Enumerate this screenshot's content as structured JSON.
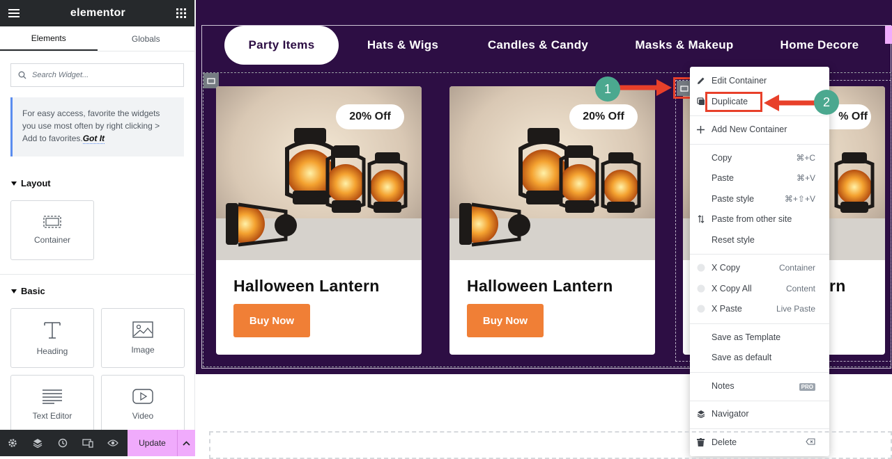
{
  "app": {
    "logo": "elementor"
  },
  "panel": {
    "tabs": [
      {
        "label": "Elements"
      },
      {
        "label": "Globals"
      }
    ],
    "search_placeholder": "Search Widget...",
    "tip_text": "For easy access, favorite the widgets you use most often by right clicking > Add to favorites.",
    "tip_link": "Got It",
    "layout_title": "Layout",
    "layout_widgets": [
      {
        "label": "Container"
      }
    ],
    "basic_title": "Basic",
    "basic_widgets": [
      {
        "label": "Heading"
      },
      {
        "label": "Image"
      },
      {
        "label": "Text Editor"
      },
      {
        "label": "Video"
      }
    ],
    "update_label": "Update"
  },
  "nav": {
    "items": [
      {
        "label": "Party Items"
      },
      {
        "label": "Hats & Wigs"
      },
      {
        "label": "Candles & Candy"
      },
      {
        "label": "Masks & Makeup"
      },
      {
        "label": "Home Decore"
      }
    ]
  },
  "cards": [
    {
      "badge": "20% Off",
      "title": "Halloween Lantern",
      "button": "Buy Now"
    },
    {
      "badge": "20% Off",
      "title": "Halloween Lantern",
      "button": "Buy Now"
    },
    {
      "badge": "% Off",
      "title": "rn"
    }
  ],
  "context_menu": {
    "items": [
      {
        "label": "Edit Container",
        "icon": "pencil-icon"
      },
      {
        "label": "Duplicate",
        "icon": "duplicate-icon"
      },
      {
        "label": "Add New Container",
        "icon": "plus-icon"
      },
      {
        "label": "Copy",
        "shortcut": "⌘+C"
      },
      {
        "label": "Paste",
        "shortcut": "⌘+V"
      },
      {
        "label": "Paste style",
        "shortcut": "⌘+⇧+V"
      },
      {
        "label": "Paste from other site",
        "icon": "arrows-icon"
      },
      {
        "label": "Reset style"
      },
      {
        "label": "X Copy",
        "shortcut": "Container",
        "icon": "xcopy-icon"
      },
      {
        "label": "X Copy All",
        "shortcut": "Content",
        "icon": "xcopy-icon"
      },
      {
        "label": "X Paste",
        "shortcut": "Live Paste",
        "icon": "xcopy-icon"
      },
      {
        "label": "Save as Template"
      },
      {
        "label": "Save as default"
      },
      {
        "label": "Notes",
        "badge": "PRO"
      },
      {
        "label": "Navigator",
        "icon": "layers-icon"
      },
      {
        "label": "Delete",
        "icon": "trash-icon",
        "shortcut_icon": "delete-key-icon"
      }
    ]
  },
  "annotations": [
    {
      "label": "1"
    },
    {
      "label": "2"
    }
  ],
  "colors": {
    "canvas": "#2d0e44",
    "accent": "#f07f36",
    "highlight": "#e8402a",
    "marker": "#4ba88f",
    "update": "#f0abfc"
  }
}
